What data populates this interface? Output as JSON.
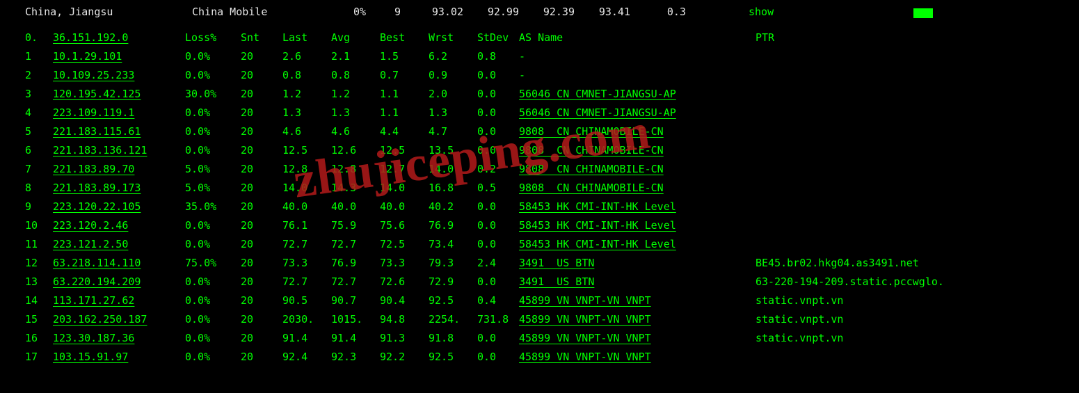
{
  "top": {
    "location": "China, Jiangsu",
    "isp": "China Mobile",
    "loss_pct": "0%",
    "count": "9",
    "m1": "93.02",
    "m2": "92.99",
    "m3": "92.39",
    "m4": "93.41",
    "m5": "0.3",
    "show": "show"
  },
  "header": {
    "hop": "0.",
    "ip": "36.151.192.0",
    "loss": "Loss%",
    "snt": "Snt",
    "last": "Last",
    "avg": "Avg",
    "best": "Best",
    "wrst": "Wrst",
    "stdev": "StDev",
    "asname": "AS Name",
    "ptr": "PTR"
  },
  "rows": [
    {
      "hop": "1",
      "ip": "10.1.29.101",
      "loss": "0.0%",
      "snt": "20",
      "last": "2.6",
      "avg": "2.1",
      "best": "1.5",
      "wrst": "6.2",
      "stdev": "0.8",
      "asname": "-",
      "asu": false,
      "ptr": ""
    },
    {
      "hop": "2",
      "ip": "10.109.25.233",
      "loss": "0.0%",
      "snt": "20",
      "last": "0.8",
      "avg": "0.8",
      "best": "0.7",
      "wrst": "0.9",
      "stdev": "0.0",
      "asname": "-",
      "asu": false,
      "ptr": ""
    },
    {
      "hop": "3",
      "ip": "120.195.42.125",
      "loss": "30.0%",
      "snt": "20",
      "last": "1.2",
      "avg": "1.2",
      "best": "1.1",
      "wrst": "2.0",
      "stdev": "0.0",
      "asname": "56046 CN CMNET-JIANGSU-AP",
      "asu": true,
      "ptr": ""
    },
    {
      "hop": "4",
      "ip": "223.109.119.1",
      "loss": "0.0%",
      "snt": "20",
      "last": "1.3",
      "avg": "1.3",
      "best": "1.1",
      "wrst": "1.3",
      "stdev": "0.0",
      "asname": "56046 CN CMNET-JIANGSU-AP",
      "asu": true,
      "ptr": ""
    },
    {
      "hop": "5",
      "ip": "221.183.115.61",
      "loss": "0.0%",
      "snt": "20",
      "last": "4.6",
      "avg": "4.6",
      "best": "4.4",
      "wrst": "4.7",
      "stdev": "0.0",
      "asname": "9808  CN CHINAMOBILE-CN",
      "asu": true,
      "ptr": ""
    },
    {
      "hop": "6",
      "ip": "221.183.136.121",
      "loss": "0.0%",
      "snt": "20",
      "last": "12.5",
      "avg": "12.6",
      "best": "12.5",
      "wrst": "13.5",
      "stdev": "0.0",
      "asname": "9808  CN CHINAMOBILE-CN",
      "asu": true,
      "ptr": ""
    },
    {
      "hop": "7",
      "ip": "221.183.89.70",
      "loss": "5.0%",
      "snt": "20",
      "last": "12.8",
      "avg": "12.8",
      "best": "12.7",
      "wrst": "14.0",
      "stdev": "0.2",
      "asname": "9808  CN CHINAMOBILE-CN",
      "asu": true,
      "ptr": ""
    },
    {
      "hop": "8",
      "ip": "221.183.89.173",
      "loss": "5.0%",
      "snt": "20",
      "last": "14.0",
      "avg": "14.3",
      "best": "14.0",
      "wrst": "16.8",
      "stdev": "0.5",
      "asname": "9808  CN CHINAMOBILE-CN",
      "asu": true,
      "ptr": ""
    },
    {
      "hop": "9",
      "ip": "223.120.22.105",
      "loss": "35.0%",
      "snt": "20",
      "last": "40.0",
      "avg": "40.0",
      "best": "40.0",
      "wrst": "40.2",
      "stdev": "0.0",
      "asname": "58453 HK CMI-INT-HK Level",
      "asu": true,
      "ptr": ""
    },
    {
      "hop": "10",
      "ip": "223.120.2.46",
      "loss": "0.0%",
      "snt": "20",
      "last": "76.1",
      "avg": "75.9",
      "best": "75.6",
      "wrst": "76.9",
      "stdev": "0.0",
      "asname": "58453 HK CMI-INT-HK Level",
      "asu": true,
      "ptr": ""
    },
    {
      "hop": "11",
      "ip": "223.121.2.50",
      "loss": "0.0%",
      "snt": "20",
      "last": "72.7",
      "avg": "72.7",
      "best": "72.5",
      "wrst": "73.4",
      "stdev": "0.0",
      "asname": "58453 HK CMI-INT-HK Level",
      "asu": true,
      "ptr": ""
    },
    {
      "hop": "12",
      "ip": "63.218.114.110",
      "loss": "75.0%",
      "snt": "20",
      "last": "73.3",
      "avg": "76.9",
      "best": "73.3",
      "wrst": "79.3",
      "stdev": "2.4",
      "asname": "3491  US BTN",
      "asu": true,
      "ptr": "BE45.br02.hkg04.as3491.net"
    },
    {
      "hop": "13",
      "ip": "63.220.194.209",
      "loss": "0.0%",
      "snt": "20",
      "last": "72.7",
      "avg": "72.7",
      "best": "72.6",
      "wrst": "72.9",
      "stdev": "0.0",
      "asname": "3491  US BTN",
      "asu": true,
      "ptr": "63-220-194-209.static.pccwglo."
    },
    {
      "hop": "14",
      "ip": "113.171.27.62",
      "loss": "0.0%",
      "snt": "20",
      "last": "90.5",
      "avg": "90.7",
      "best": "90.4",
      "wrst": "92.5",
      "stdev": "0.4",
      "asname": "45899 VN VNPT-VN VNPT",
      "asu": true,
      "ptr": "static.vnpt.vn"
    },
    {
      "hop": "15",
      "ip": "203.162.250.187",
      "loss": "0.0%",
      "snt": "20",
      "last": "2030.",
      "avg": "1015.",
      "best": "94.8",
      "wrst": "2254.",
      "stdev": "731.8",
      "asname": "45899 VN VNPT-VN VNPT",
      "asu": true,
      "ptr": "static.vnpt.vn"
    },
    {
      "hop": "16",
      "ip": "123.30.187.36",
      "loss": "0.0%",
      "snt": "20",
      "last": "91.4",
      "avg": "91.4",
      "best": "91.3",
      "wrst": "91.8",
      "stdev": "0.0",
      "asname": "45899 VN VNPT-VN VNPT",
      "asu": true,
      "ptr": "static.vnpt.vn"
    },
    {
      "hop": "17",
      "ip": "103.15.91.97",
      "loss": "0.0%",
      "snt": "20",
      "last": "92.4",
      "avg": "92.3",
      "best": "92.2",
      "wrst": "92.5",
      "stdev": "0.0",
      "asname": "45899 VN VNPT-VN VNPT",
      "asu": true,
      "ptr": ""
    }
  ],
  "watermark": "zhujiceping.com"
}
